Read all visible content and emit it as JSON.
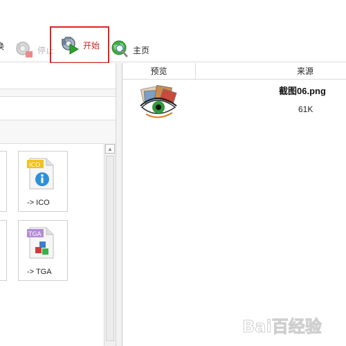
{
  "toolbar": {
    "cut_label": "换",
    "stop_label": "停止",
    "start_label": "开始",
    "home_label": "主页"
  },
  "tiles": [
    {
      "label": "-> ICO",
      "badge": "ICO"
    },
    {
      "label": "-> TGA",
      "badge": "TGA"
    }
  ],
  "file_list": {
    "columns": [
      "预览",
      "来源"
    ],
    "rows": [
      {
        "name": "截图06.png",
        "size": "61K"
      }
    ]
  },
  "watermark": {
    "text": "Bai百经验"
  },
  "colors": {
    "highlight_border": "#e02020",
    "start_text": "#cc2222",
    "disabled_text": "#b9b9b9"
  }
}
